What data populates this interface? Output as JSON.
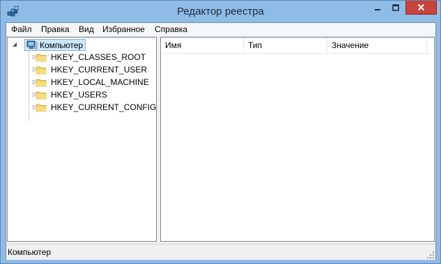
{
  "window": {
    "title": "Редактор реестра",
    "colors": {
      "frame": "#8fbce7",
      "close_button": "#c8433b",
      "selection": "#cce8ff"
    }
  },
  "menu": {
    "items": [
      {
        "label": "Файл"
      },
      {
        "label": "Правка"
      },
      {
        "label": "Вид"
      },
      {
        "label": "Избранное"
      },
      {
        "label": "Справка"
      }
    ]
  },
  "tree": {
    "root": {
      "label": "Компьютер",
      "icon": "computer-icon",
      "expanded": true,
      "selected": true
    },
    "items": [
      {
        "label": "HKEY_CLASSES_ROOT",
        "icon": "folder-icon"
      },
      {
        "label": "HKEY_CURRENT_USER",
        "icon": "folder-icon"
      },
      {
        "label": "HKEY_LOCAL_MACHINE",
        "icon": "folder-icon"
      },
      {
        "label": "HKEY_USERS",
        "icon": "folder-icon"
      },
      {
        "label": "HKEY_CURRENT_CONFIG",
        "icon": "folder-icon"
      }
    ]
  },
  "list": {
    "columns": [
      {
        "label": "Имя"
      },
      {
        "label": "Тип"
      },
      {
        "label": "Значение"
      }
    ]
  },
  "status": {
    "text": "Компьютер"
  }
}
